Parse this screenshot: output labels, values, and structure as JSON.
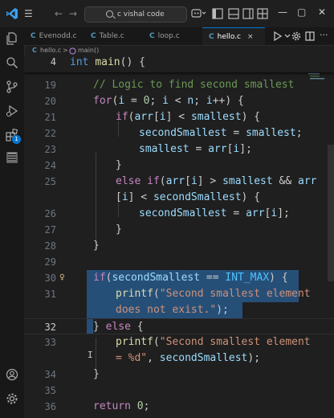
{
  "titlebar": {
    "search_text": "c vishal code"
  },
  "tabs": [
    {
      "icon": "C",
      "label": "Evenodd.c"
    },
    {
      "icon": "C",
      "label": "Table.c"
    },
    {
      "icon": "C",
      "label": "loop.c"
    },
    {
      "icon": "C",
      "label": "hello.c",
      "close": "×"
    }
  ],
  "breadcrumb": {
    "file": "hello.c",
    "sep": ">",
    "symbol": "main()"
  },
  "sticky": {
    "number": "4"
  },
  "line_numbers": [
    "19",
    "20",
    "21",
    "22",
    "23",
    "24",
    "25",
    "",
    "26",
    "27",
    "28",
    "29",
    "30",
    "31",
    "",
    "32",
    "33",
    "",
    "34",
    "35",
    "36"
  ],
  "badge": "1",
  "colors": {
    "accent": "#0078d4",
    "selection": "#264f78",
    "keyword": "#c586c0",
    "type": "#569cd6",
    "function": "#dcdcaa",
    "variable": "#9cdcfe",
    "string": "#ce9178",
    "comment": "#6a9955",
    "number": "#b5cea8",
    "constant": "#4fc1ff"
  },
  "t": {
    "int": "int",
    "main": "main",
    "open": "() {",
    "comment": "// Logic to find second smallest",
    "for": "for",
    "i": "i",
    "n": "n",
    "if": "if",
    "else": "else",
    "arr": "arr",
    "smallest": "smallest",
    "secondSmallest": "secondSmallest",
    "INT_MAX": "INT_MAX",
    "printf": "printf",
    "zero": "0",
    "return": "return",
    "str1a": "\"Second smallest element",
    "str1b": "does not exist.\"",
    "str2a": "\"Second smallest element",
    "str2b": "= %d\""
  }
}
